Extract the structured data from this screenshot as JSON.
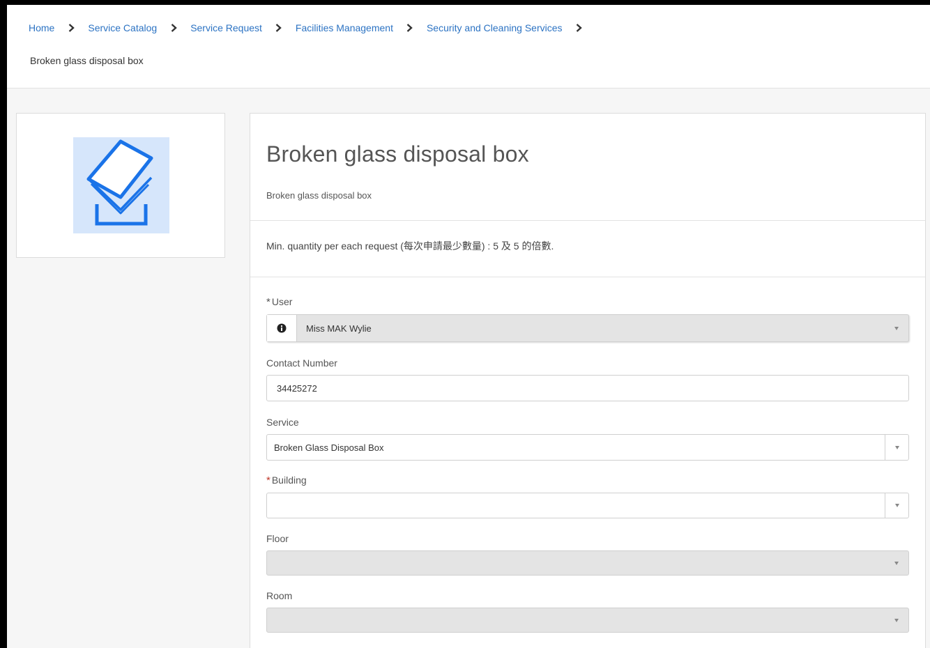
{
  "breadcrumb": {
    "items": [
      "Home",
      "Service Catalog",
      "Service Request",
      "Facilities Management",
      "Security and Cleaning Services"
    ],
    "current": "Broken glass disposal box"
  },
  "item": {
    "image_icon": "box-icon",
    "title": "Broken glass disposal box",
    "subtitle": "Broken glass disposal box",
    "note": "Min. quantity per each request (每次申請最少數量) : 5 及 5 的倍數."
  },
  "form": {
    "user": {
      "required_mark": "*",
      "label": "User",
      "value": "Miss MAK Wylie"
    },
    "contact": {
      "label": "Contact Number",
      "value": "34425272"
    },
    "service": {
      "label": "Service",
      "value": "Broken Glass Disposal Box"
    },
    "building": {
      "required_mark": "*",
      "label": "Building",
      "value": ""
    },
    "floor": {
      "label": "Floor",
      "value": ""
    },
    "room": {
      "label": "Room",
      "value": ""
    }
  },
  "colors": {
    "link": "#2c73c3",
    "required": "#c0392b",
    "icon_blue": "#1a73e8",
    "icon_bg": "#d6e6fb"
  }
}
